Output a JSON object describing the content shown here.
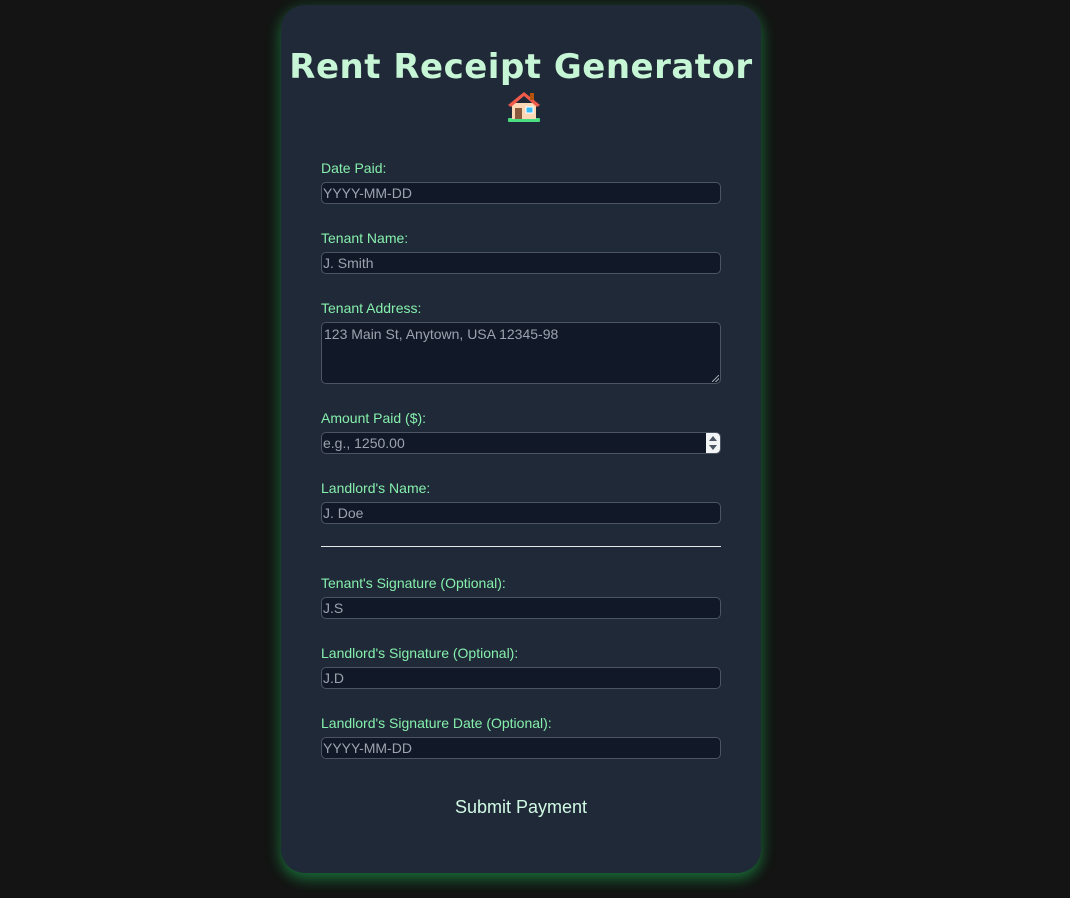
{
  "form": {
    "title": "Rent Receipt Generator",
    "title_icon": "house-with-garden-icon",
    "fields": {
      "date_paid": {
        "label": "Date Paid:",
        "placeholder": "YYYY-MM-DD"
      },
      "tenant_name": {
        "label": "Tenant Name:",
        "placeholder": "J. Smith"
      },
      "tenant_address": {
        "label": "Tenant Address:",
        "placeholder": "123 Main St, Anytown, USA 12345-98"
      },
      "amount_paid": {
        "label": "Amount Paid ($):",
        "placeholder": "e.g., 1250.00"
      },
      "landlord_name": {
        "label": "Landlord's Name:",
        "placeholder": "J. Doe"
      },
      "tenant_signature": {
        "label": "Tenant's Signature (Optional):",
        "placeholder": "J.S"
      },
      "landlord_signature": {
        "label": "Landlord's Signature (Optional):",
        "placeholder": "J.D"
      },
      "landlord_signature_date": {
        "label": "Landlord's Signature Date (Optional):",
        "placeholder": "YYYY-MM-DD"
      }
    },
    "submit_label": "Submit Payment"
  },
  "colors": {
    "page_background": "#141414",
    "card_background": "#1f2937",
    "title": "#c6f6d5",
    "label": "#86efac",
    "input_background": "#111827",
    "glow": "#22c55e"
  }
}
